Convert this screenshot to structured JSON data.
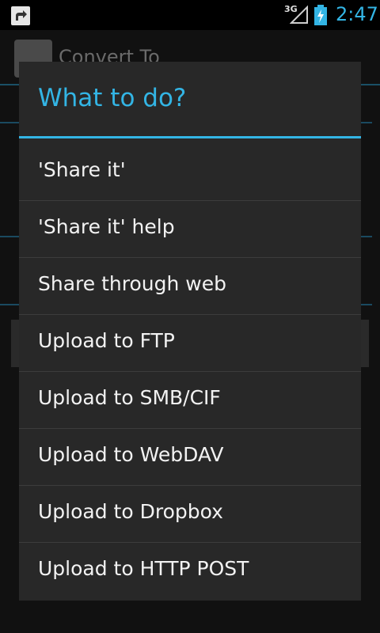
{
  "status_bar": {
    "network": "3G",
    "time": "2:47"
  },
  "background_app": {
    "title": "Convert To"
  },
  "dialog": {
    "title": "What to do?",
    "options": [
      {
        "label": "'Share it'"
      },
      {
        "label": "'Share it' help"
      },
      {
        "label": "Share through web"
      },
      {
        "label": "Upload to FTP"
      },
      {
        "label": "Upload to SMB/CIF"
      },
      {
        "label": "Upload to WebDAV"
      },
      {
        "label": "Upload to Dropbox"
      },
      {
        "label": "Upload to HTTP POST"
      }
    ]
  },
  "colors": {
    "accent": "#33b5e5",
    "dialog_bg": "#282828",
    "screen_bg": "#000000"
  }
}
